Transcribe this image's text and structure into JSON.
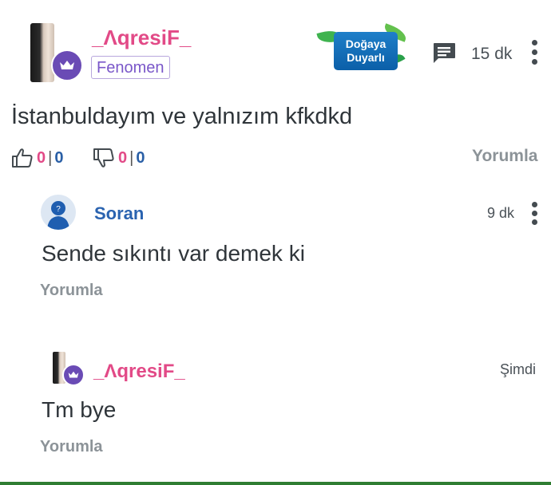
{
  "post": {
    "username": "_ΛqresiF_",
    "badge": "Fenomen",
    "nature_badge": {
      "line1": "Doğaya",
      "line2": "Duyarlı"
    },
    "time": "15 dk",
    "text": "İstanbuldayım ve yalnızım kfkdkd",
    "likes": {
      "a": "0",
      "sep": "|",
      "b": "0"
    },
    "dislikes": {
      "a": "0",
      "sep": "|",
      "b": "0"
    },
    "reply_label": "Yorumla"
  },
  "replies": [
    {
      "username": "Soran",
      "time": "9 dk",
      "text": "Sende sıkıntı var demek ki",
      "reply_label": "Yorumla"
    },
    {
      "username": "_ΛqresiF_",
      "time": "Şimdi",
      "text": "Tm bye",
      "reply_label": "Yorumla"
    }
  ],
  "colors": {
    "username": "#e24a87",
    "badge": "#7a57c9",
    "link_blue": "#2a63b0",
    "muted": "#8c9398",
    "bottom_bar": "#2f7d32"
  }
}
